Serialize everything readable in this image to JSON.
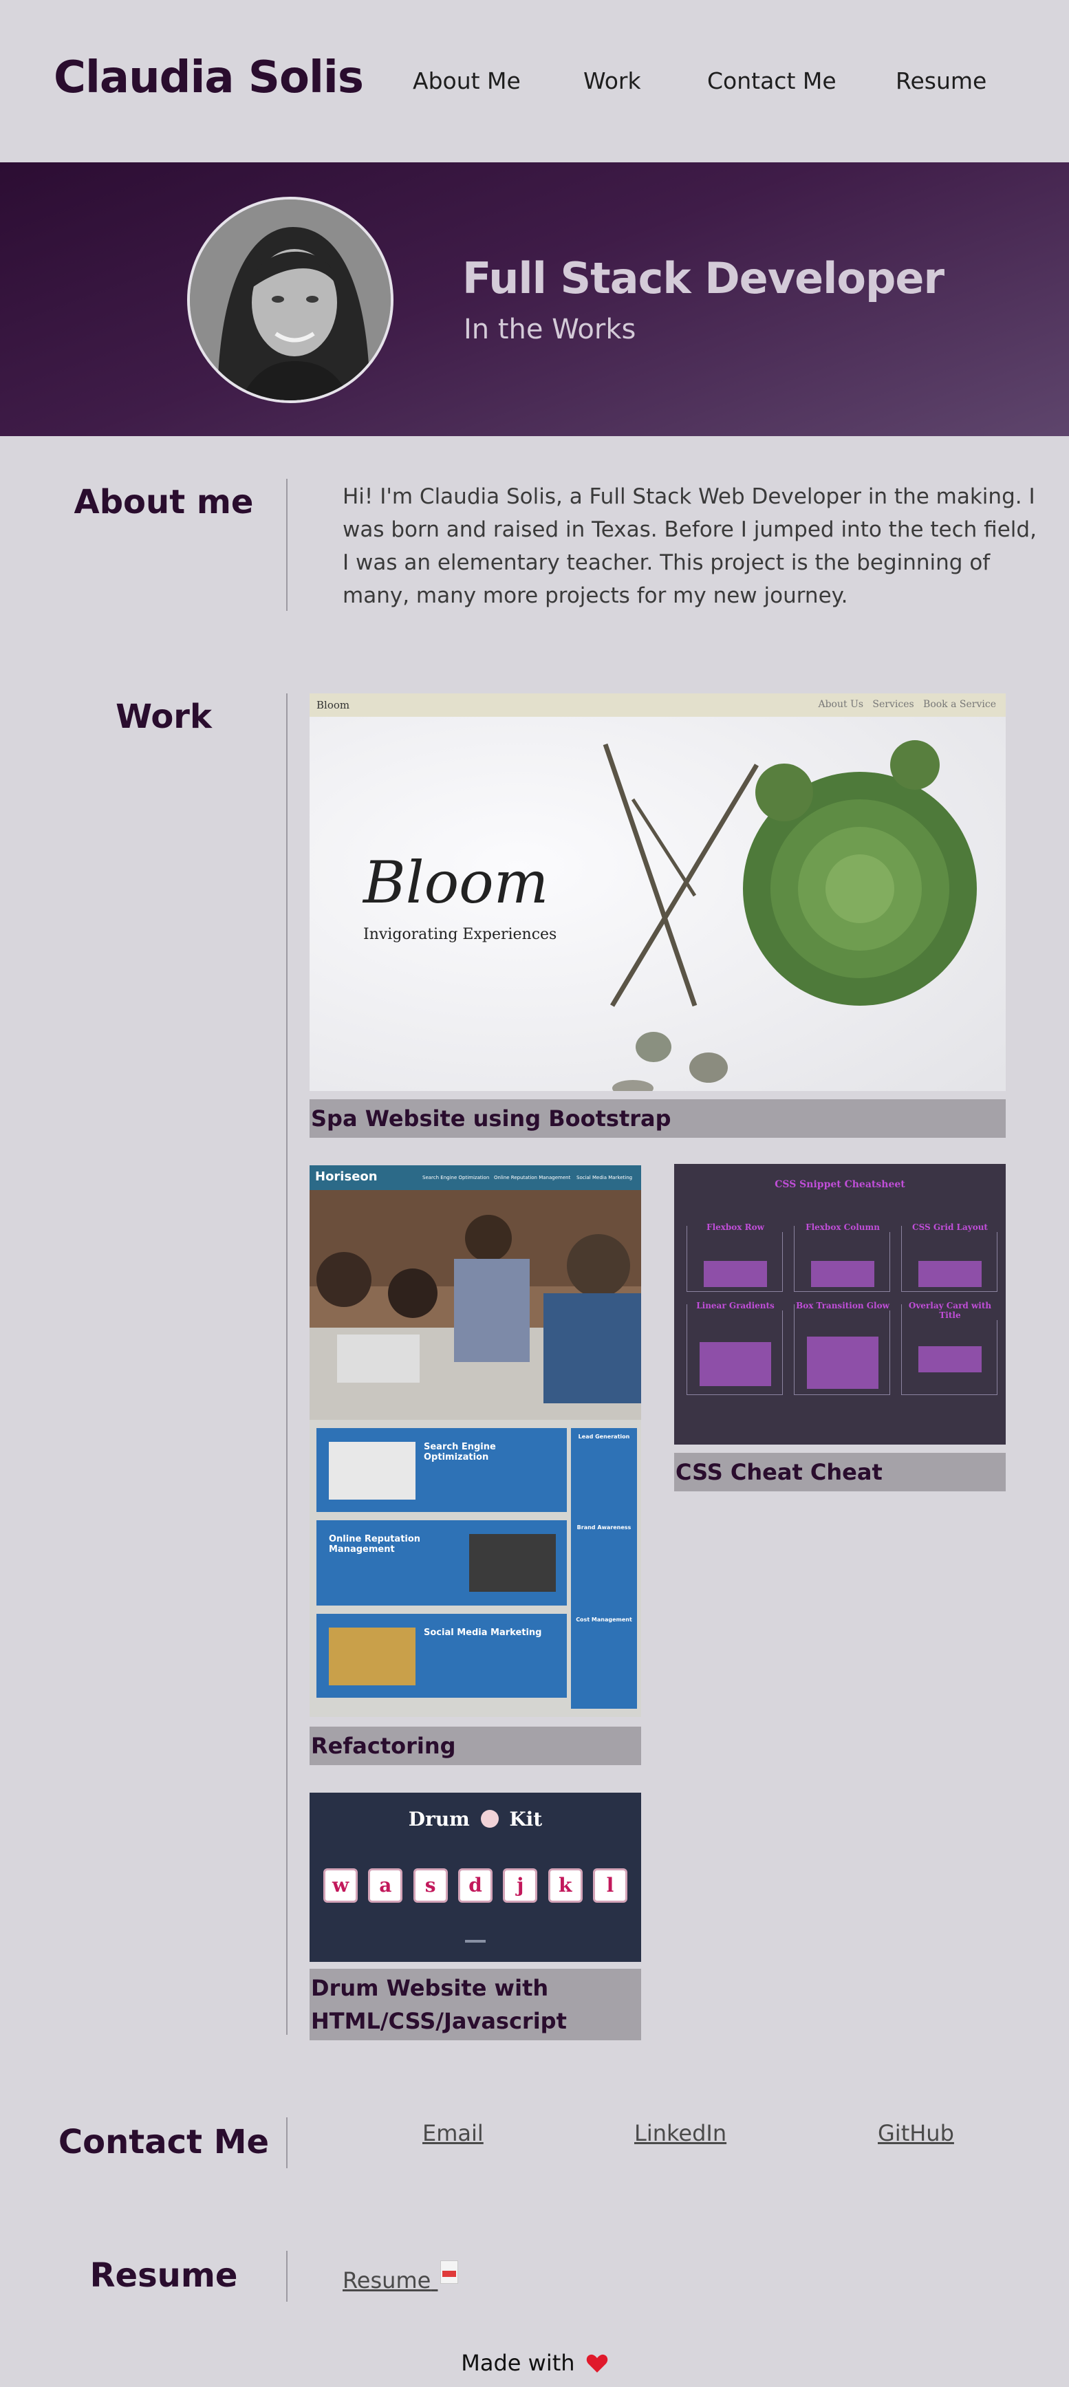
{
  "header": {
    "brand": "Claudia Solis",
    "nav": [
      "About Me",
      "Work",
      "Contact Me",
      "Resume"
    ]
  },
  "hero": {
    "title": "Full Stack Developer",
    "subtitle": "In the Works"
  },
  "about": {
    "title": "About me",
    "text": "Hi! I'm Claudia Solis, a Full Stack Web Developer in the making. I was born and raised in Texas. Before I jumped into the tech field, I was an elementary teacher. This project is the beginning of many, many more projects for my new journey."
  },
  "work": {
    "title": "Work",
    "projects": [
      {
        "caption": "Spa Website using Bootstrap",
        "preview": {
          "brand": "Bloom",
          "nav": "About Us   Services   Book a Service",
          "headline": "Bloom",
          "tagline": "Invigorating Experiences"
        }
      },
      {
        "caption": "Refactoring",
        "preview": {
          "brand": "Horiseon",
          "nav": [
            "Search Engine Optimization",
            "Online Reputation Management",
            "Social Media Marketing"
          ],
          "blocks": [
            "Search Engine Optimization",
            "Online Reputation Management",
            "Social Media Marketing"
          ],
          "side": [
            "Lead Generation",
            "Brand Awareness",
            "Cost Management"
          ]
        }
      },
      {
        "caption": "CSS Cheat Cheat",
        "preview": {
          "title": "CSS Snippet Cheatsheet",
          "cells": [
            "Flexbox Row",
            "Flexbox Column",
            "CSS Grid Layout",
            "Linear Gradients",
            "Box Transition Glow",
            "Overlay Card with Title"
          ]
        }
      },
      {
        "caption": "Drum Website with HTML/CSS/Javascript",
        "preview": {
          "title": "Drum",
          "title_end": "Kit",
          "keys": [
            "w",
            "a",
            "s",
            "d",
            "j",
            "k",
            "l"
          ]
        }
      }
    ]
  },
  "contact": {
    "title": "Contact Me",
    "links": [
      "Email",
      "LinkedIn",
      "GitHub"
    ]
  },
  "resume": {
    "title": "Resume",
    "link": "Resume"
  },
  "footer": {
    "text": "Made with"
  },
  "colors": {
    "brand": "#2a0d2e",
    "hero_start": "#2c0d33",
    "hero_end": "#5e456c",
    "background": "#d8d6dc",
    "caption_bg": "#a5a2a8",
    "heart": "#e0192b"
  }
}
